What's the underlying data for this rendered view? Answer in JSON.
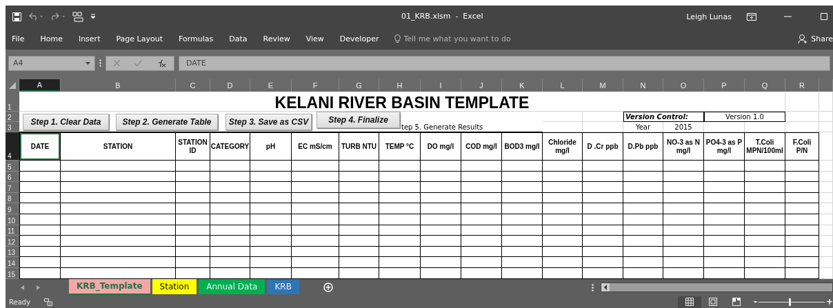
{
  "window": {
    "title": "01_KRB.xlsm  -  Excel",
    "user": "Leigh Lunas"
  },
  "ribbon_tabs": [
    "File",
    "Home",
    "Insert",
    "Page Layout",
    "Formulas",
    "Data",
    "Review",
    "View",
    "Developer"
  ],
  "tell_me": {
    "placeholder": "Tell me what you want to do"
  },
  "share": "Share",
  "formula_bar": {
    "name_box": "A4",
    "formula": "DATE"
  },
  "columns": [
    {
      "letter": "A",
      "selected": true
    },
    {
      "letter": "B",
      "selected": false
    },
    {
      "letter": "C",
      "selected": false
    },
    {
      "letter": "D",
      "selected": false
    },
    {
      "letter": "E",
      "selected": false
    },
    {
      "letter": "F",
      "selected": false
    },
    {
      "letter": "G",
      "selected": false
    },
    {
      "letter": "H",
      "selected": false
    },
    {
      "letter": "I",
      "selected": false
    },
    {
      "letter": "J",
      "selected": false
    },
    {
      "letter": "K",
      "selected": false
    },
    {
      "letter": "L",
      "selected": false
    },
    {
      "letter": "M",
      "selected": false
    },
    {
      "letter": "N",
      "selected": false
    },
    {
      "letter": "O",
      "selected": false
    },
    {
      "letter": "P",
      "selected": false
    },
    {
      "letter": "Q",
      "selected": false
    },
    {
      "letter": "R",
      "selected": false
    }
  ],
  "row_numbers": [
    {
      "label": "1",
      "selected": false
    },
    {
      "label": "2",
      "selected": false
    },
    {
      "label": "3",
      "selected": false
    },
    {
      "label": "4",
      "selected": true
    },
    {
      "label": "5",
      "selected": false
    },
    {
      "label": "6",
      "selected": false
    },
    {
      "label": "7",
      "selected": false
    },
    {
      "label": "8",
      "selected": false
    },
    {
      "label": "9",
      "selected": false
    },
    {
      "label": "10",
      "selected": false
    },
    {
      "label": "11",
      "selected": false
    },
    {
      "label": "12",
      "selected": false
    },
    {
      "label": "13",
      "selected": false
    },
    {
      "label": "14",
      "selected": false
    },
    {
      "label": "15",
      "selected": false
    }
  ],
  "sheet": {
    "title": "KELANI RIVER BASIN TEMPLATE",
    "buttons": [
      "Step 1. Clear Data",
      "Step 2. Generate Table",
      "Step 3. Save as CSV",
      "Step 4. Finalize"
    ],
    "note": "tep 5. Generate Results",
    "version_label": "Version Control:",
    "version_value": "Version 1.0",
    "year_label": "Year",
    "year_value": "2015",
    "headers": [
      {
        "text": "DATE",
        "selected": true
      },
      {
        "text": "STATION",
        "selected": false
      },
      {
        "text": "STATION ID",
        "selected": false
      },
      {
        "text": "CATEGORY",
        "selected": false
      },
      {
        "text": "pH",
        "selected": false
      },
      {
        "text": "EC mS/cm",
        "selected": false
      },
      {
        "text": "TURB NTU",
        "selected": false
      },
      {
        "text": "TEMP °C",
        "selected": false
      },
      {
        "text": "DO mg/l",
        "selected": false
      },
      {
        "text": "COD mg/l",
        "selected": false
      },
      {
        "text": "BOD3 mg/l",
        "selected": false
      },
      {
        "text": "Chloride mg/l",
        "selected": false
      },
      {
        "text": "D .Cr ppb",
        "selected": false
      },
      {
        "text": "D.Pb  ppb",
        "selected": false
      },
      {
        "text": "NO-3 as N mg/l",
        "selected": false
      },
      {
        "text": "PO4-3 as P mg/l",
        "selected": false
      },
      {
        "text": "T.Coli MPN/100ml",
        "selected": false
      },
      {
        "text": "F.Coli P/N",
        "selected": false
      }
    ]
  },
  "sheet_tabs": [
    {
      "label": "KRB_Template",
      "color": "#f4a7a7",
      "selected": true
    },
    {
      "label": "Station",
      "color": "#ffff00",
      "selected": false
    },
    {
      "label": "Annual Data",
      "color": "#00b050",
      "selected": false
    },
    {
      "label": "KRB",
      "color": "#2e75b6",
      "selected": false
    }
  ],
  "status_bar": {
    "status": "Ready",
    "views": [
      {
        "kind": "normal",
        "selected": true
      },
      {
        "kind": "page-layout",
        "selected": false
      },
      {
        "kind": "page-break",
        "selected": false
      }
    ],
    "zoom_minus": "-",
    "zoom_plus": "+",
    "zoom": {
      "level": 0.47
    }
  }
}
